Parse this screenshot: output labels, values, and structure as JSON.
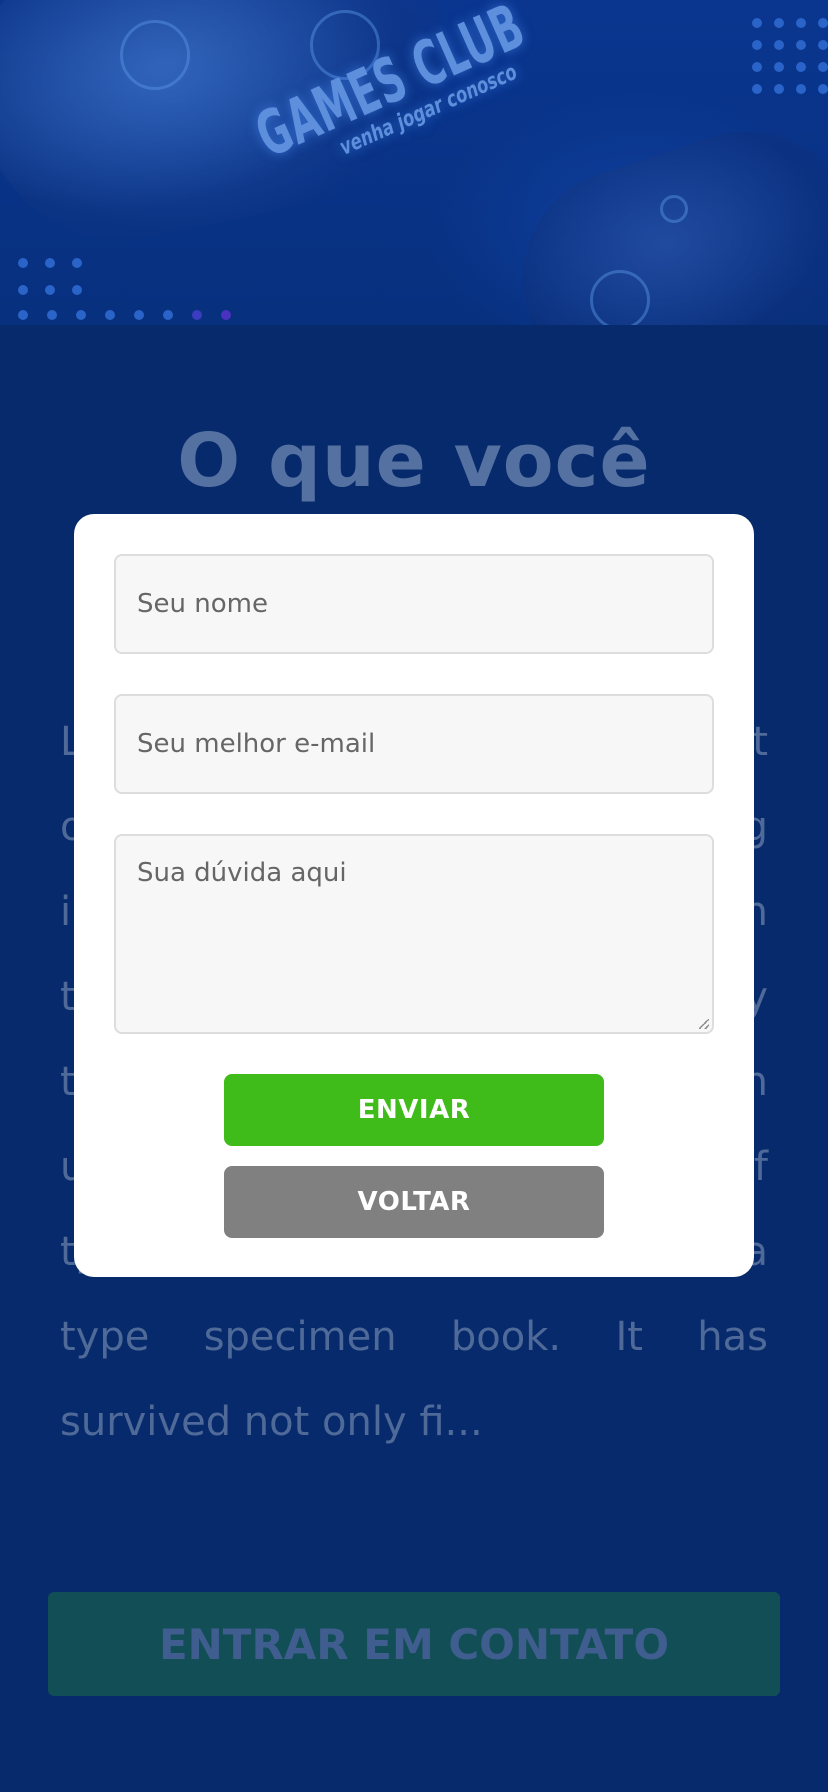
{
  "hero": {
    "logo_title": "GAMES CLUB",
    "logo_subtitle": "venha jogar conosco"
  },
  "section": {
    "title": "O que você",
    "body_text": "Lorem Ipsum is simply dummy text of the printing and typesetting industry. Lorem Ipsum has been the industry's standard dummy text ever since the 1500s, when an unknown printer took a galley of type and scrambled it to make a type specimen book. It has survived not only fi..."
  },
  "contact_button": {
    "label": "ENTRAR EM CONTATO"
  },
  "modal": {
    "name_placeholder": "Seu nome",
    "email_placeholder": "Seu melhor e-mail",
    "question_placeholder": "Sua dúvida aqui",
    "send_label": "ENVIAR",
    "back_label": "VOLTAR"
  },
  "colors": {
    "background": "#062a6b",
    "send_button": "#3fbb1a",
    "back_button": "#808080",
    "contact_button": "#124e55"
  }
}
